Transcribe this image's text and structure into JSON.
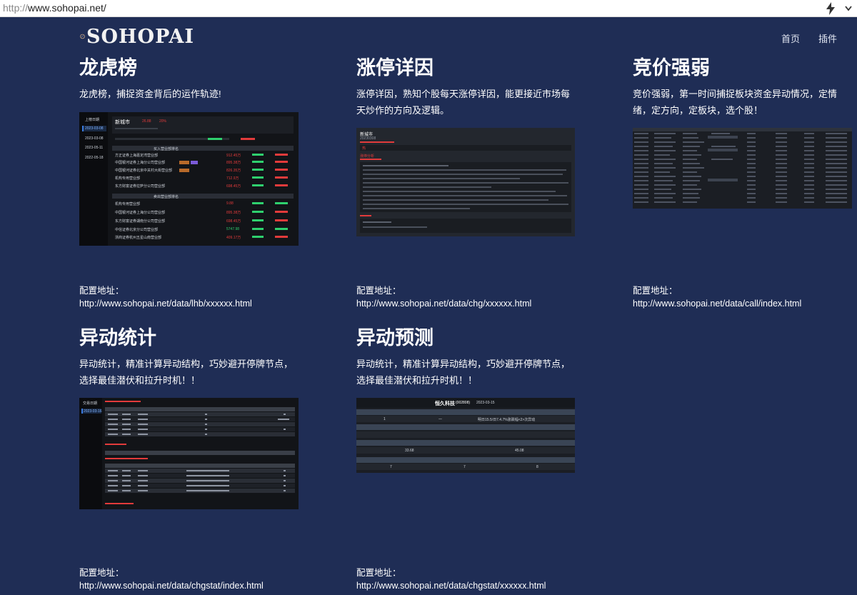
{
  "browser": {
    "url_proto": "http://",
    "url_host": "www.sohopai.net/"
  },
  "header": {
    "logo_text": "SOHOPAI",
    "nav": [
      {
        "label": "首页"
      },
      {
        "label": "插件"
      }
    ]
  },
  "cards": [
    {
      "title": "龙虎榜",
      "desc": "龙虎榜，捕捉资金背后的运作轨迹!",
      "cfg_label": "配置地址：",
      "cfg_url": "http://www.sohopai.net/data/lhb/xxxxxx.html",
      "shot": {
        "menu_title": "上榜日期",
        "dates": [
          "2023-03-08",
          "2023-03-08",
          "2023-05-11",
          "2022-05-18"
        ],
        "stock": "新城市",
        "price": "26.88",
        "pct": "20%",
        "buy_header": "买入营业部排名",
        "sell_header": "卖出营业部排名",
        "buy_rows": [
          "方正证券上海嘉定湾营业部",
          "中国银河证券上海分公司营业部",
          "中国银河证券北京中关村大街营业部",
          "机构专用营业部",
          "东方财富证券拉萨分公司营业部"
        ],
        "sell_rows": [
          "机构专用营业部",
          "中国银河证券上海分公司营业部",
          "东方财富证券湖南分公司营业部",
          "中信证券北京分公司营业部",
          "浙商证券杭州五星山南营业部"
        ],
        "buy_values": [
          "912.45万",
          "895.38万",
          "826.35万",
          "712.9万",
          "698.45万"
        ],
        "sell_values": [
          "9.88",
          "895.38万",
          "698.45万",
          "5747.98",
          "409.17万"
        ]
      }
    },
    {
      "title": "涨停详因",
      "desc": "涨停详因，熟知个股每天涨停详因，能更接近市场每天炒作的方向及逻辑。",
      "cfg_label": "配置地址：",
      "cfg_url": "http://www.sohopai.net/data/chg/xxxxxx.html",
      "shot": {
        "stock": "新城市",
        "sub": "20230308",
        "badge": "热",
        "section": "涨停分析"
      }
    },
    {
      "title": "竞价强弱",
      "desc": "竞价强弱，第一时间捕捉板块资金异动情况，定情绪，定方向，定板块，选个股！",
      "cfg_label": "配置地址：",
      "cfg_url": "http://www.sohopai.net/data/call/index.html"
    },
    {
      "title": "异动统计",
      "desc": "异动统计，精准计算异动结构，巧妙避开停牌节点，选择最佳潜伏和拉升时机！！",
      "cfg_label": "配置地址：",
      "cfg_url": "http://www.sohopai.net/data/chgstat/index.html",
      "shot": {
        "menu_title": "交易日期",
        "date": "2023-03-16"
      }
    },
    {
      "title": "异动预测",
      "desc": "异动统计，精准计算异动结构，巧妙避开停牌节点，选择最佳潜伏和拉升时机！！",
      "cfg_label": "配置地址：",
      "cfg_url": "http://www.sohopai.net/data/chgstat/xxxxxx.html",
      "shot": {
        "title": "恒久科技",
        "code": "(002808)",
        "date": "2023-03-15",
        "val1": "1",
        "val2": "一",
        "val3": "明日15.5/日7.4.7%涨跌幅<2>次异动",
        "val4": "33.68",
        "val5": "45.08",
        "val6": "7",
        "val7": "7",
        "val8": "8"
      }
    }
  ],
  "colors": {
    "background": "#1f2d55",
    "shot_bg": "#0f1115",
    "accent_red": "#e23b3b",
    "accent_green": "#2fd06e",
    "accent_blue": "#3a7be0"
  }
}
